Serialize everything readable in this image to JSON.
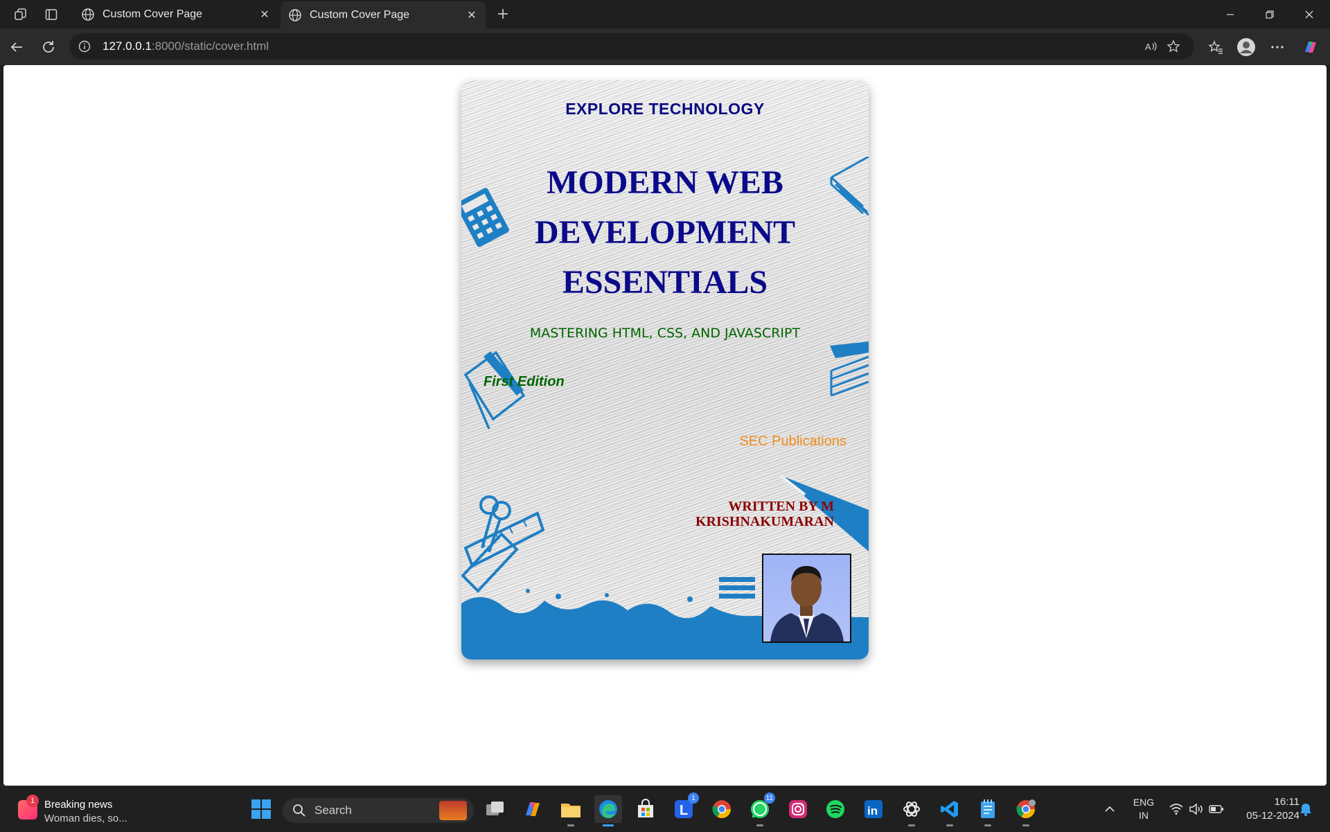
{
  "browser": {
    "tabs": [
      {
        "title": "Custom Cover Page",
        "active": false
      },
      {
        "title": "Custom Cover Page",
        "active": true
      }
    ],
    "address": {
      "host": "127.0.0.1",
      "path": ":8000/static/cover.html"
    }
  },
  "cover": {
    "kicker": "EXPLORE TECHNOLOGY",
    "title_lines": [
      "MODERN WEB",
      "DEVELOPMENT",
      "ESSENTIALS"
    ],
    "subtitle": "MASTERING HTML, CSS, AND JAVASCRIPT",
    "edition": "First Edition",
    "publisher": "SEC Publications",
    "author_lines": [
      "WRITTEN BY M",
      "KRISHNAKUMARAN"
    ],
    "colors": {
      "title": "#0a0a8a",
      "subtitle": "#006400",
      "publisher": "#f28c1c",
      "author": "#8b0000",
      "decor": "#1e7fc4"
    }
  },
  "taskbar": {
    "news": {
      "badge": "1",
      "headline": "Breaking news",
      "teaser": "Woman dies, so..."
    },
    "search_label": "Search",
    "apps": [
      {
        "name": "start-icon"
      },
      {
        "name": "task-view-icon"
      },
      {
        "name": "copilot-icon"
      },
      {
        "name": "file-explorer-icon"
      },
      {
        "name": "edge-icon"
      },
      {
        "name": "store-icon"
      },
      {
        "name": "l-app-icon",
        "badge": "1"
      },
      {
        "name": "chrome-icon"
      },
      {
        "name": "whatsapp-icon",
        "badge": "11"
      },
      {
        "name": "instagram-icon"
      },
      {
        "name": "spotify-icon"
      },
      {
        "name": "linkedin-icon"
      },
      {
        "name": "chatgpt-icon"
      },
      {
        "name": "vscode-icon"
      },
      {
        "name": "notepad-icon"
      },
      {
        "name": "chrome-profile-icon"
      }
    ],
    "tray": {
      "lang_top": "ENG",
      "lang_bottom": "IN",
      "time": "16:11",
      "date": "05-12-2024"
    }
  }
}
